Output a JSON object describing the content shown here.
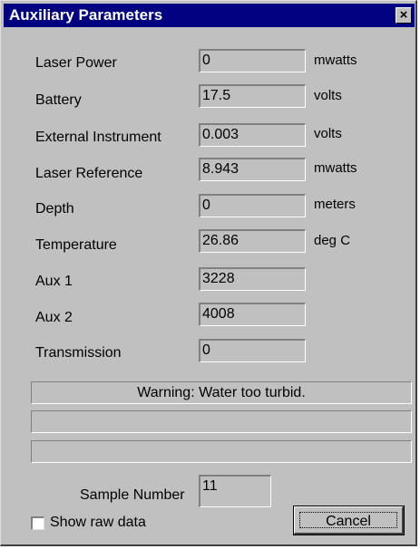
{
  "window": {
    "title": "Auxiliary Parameters",
    "close_glyph": "×"
  },
  "params": [
    {
      "label": "Laser Power",
      "value": "0",
      "unit": "mwatts"
    },
    {
      "label": "Battery",
      "value": "17.5",
      "unit": "volts"
    },
    {
      "label": "External Instrument",
      "value": "0.003",
      "unit": "volts"
    },
    {
      "label": "Laser Reference",
      "value": "8.943",
      "unit": "mwatts"
    },
    {
      "label": "Depth",
      "value": "0",
      "unit": "meters"
    },
    {
      "label": "Temperature",
      "value": "26.86",
      "unit": "deg C"
    },
    {
      "label": "Aux 1",
      "value": "3228",
      "unit": ""
    },
    {
      "label": "Aux 2",
      "value": "4008",
      "unit": ""
    },
    {
      "label": "Transmission",
      "value": "0",
      "unit": ""
    }
  ],
  "status": {
    "line1": "Warning: Water too turbid.",
    "line2": "",
    "line3": ""
  },
  "sample": {
    "label": "Sample Number",
    "value": "11"
  },
  "raw_data": {
    "label": "Show raw data",
    "checked": false
  },
  "cancel": {
    "label": "Cancel"
  }
}
